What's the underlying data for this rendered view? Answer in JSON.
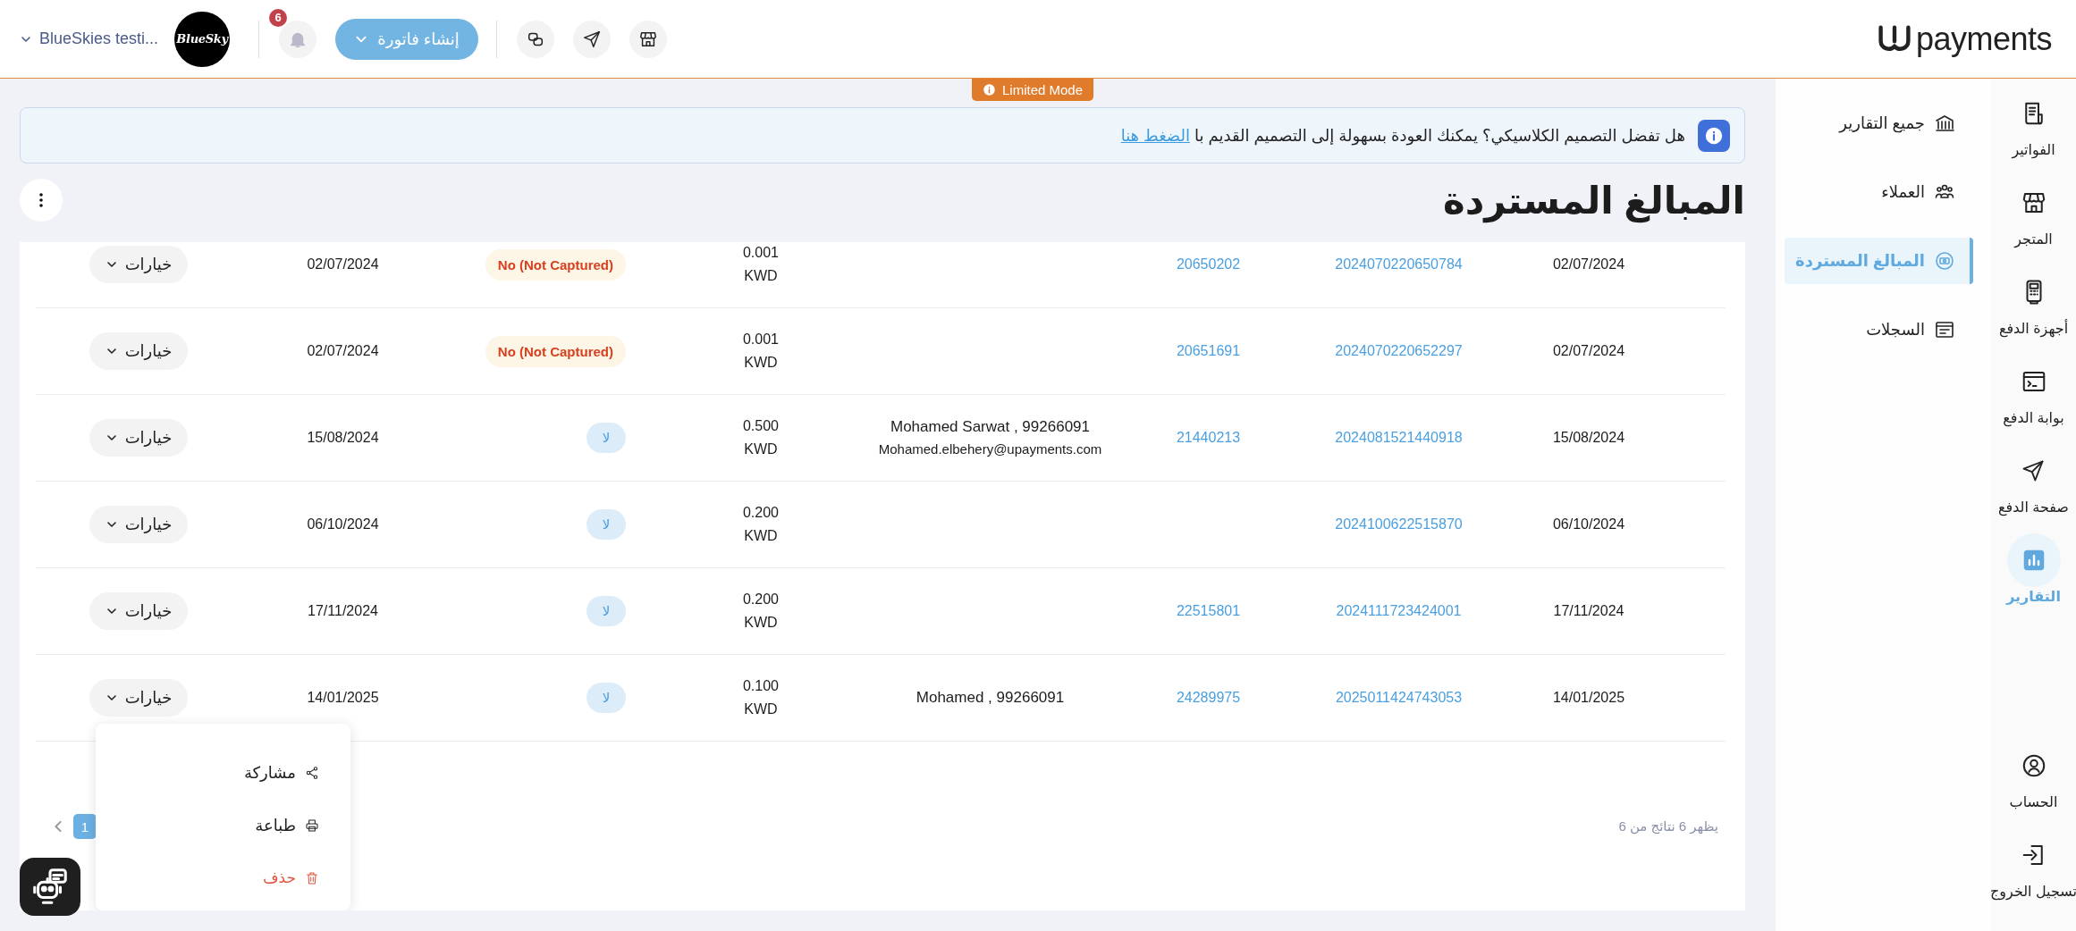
{
  "topbar": {
    "account": "BlueSkies testi...",
    "avatar": "BlueSky",
    "notifications": "6",
    "create_button": "إنشاء فاتورة",
    "logo": "payments"
  },
  "limited_mode": "Limited Mode",
  "banner": {
    "text": "هل تفضل التصميم الكلاسيكي؟ يمكنك العودة بسهولة إلى التصميم القديم با",
    "link": "الضغط هنا"
  },
  "page_title": "المبالغ المستردة",
  "rows": [
    {
      "date": "02/07/2024",
      "reference": "2024070220650784",
      "payment_id": "20650202",
      "amount": "0.001",
      "currency": "KWD",
      "status": {
        "kind": "not_captured",
        "label": "No (Not Captured)"
      },
      "refund_date": "02/07/2024",
      "options": "خيارات"
    },
    {
      "date": "02/07/2024",
      "reference": "2024070220652297",
      "payment_id": "20651691",
      "amount": "0.001",
      "currency": "KWD",
      "status": {
        "kind": "not_captured",
        "label": "No (Not Captured)"
      },
      "refund_date": "02/07/2024",
      "options": "خيارات"
    },
    {
      "date": "15/08/2024",
      "reference": "2024081521440918",
      "payment_id": "21440213",
      "customer": "Mohamed Sarwat , 99266091",
      "email": "Mohamed.elbehery@upayments.com",
      "amount": "0.500",
      "currency": "KWD",
      "status": {
        "kind": "no",
        "label": "لا"
      },
      "refund_date": "15/08/2024",
      "options": "خيارات"
    },
    {
      "date": "06/10/2024",
      "reference": "2024100622515870",
      "amount": "0.200",
      "currency": "KWD",
      "status": {
        "kind": "no",
        "label": "لا"
      },
      "refund_date": "06/10/2024",
      "options": "خيارات"
    },
    {
      "date": "17/11/2024",
      "reference": "2024111723424001",
      "payment_id": "22515801",
      "amount": "0.200",
      "currency": "KWD",
      "status": {
        "kind": "no",
        "label": "لا"
      },
      "refund_date": "17/11/2024",
      "options": "خيارات"
    },
    {
      "date": "14/01/2025",
      "reference": "2025011424743053",
      "payment_id": "24289975",
      "customer": "Mohamed , 99266091",
      "amount": "0.100",
      "currency": "KWD",
      "status": {
        "kind": "no",
        "label": "لا"
      },
      "refund_date": "14/01/2025",
      "options": "خيارات"
    }
  ],
  "row_menu": [
    {
      "label": "مشاركة",
      "kind": "share"
    },
    {
      "label": "طباعة",
      "kind": "print"
    },
    {
      "label": "حذف",
      "kind": "delete"
    }
  ],
  "pagination": {
    "summary": "يظهر 6 نتائج من 6",
    "pages": [
      {
        "label": "1",
        "selected": true
      }
    ]
  },
  "subnav": [
    {
      "label": "جميع التقارير",
      "selected": false
    },
    {
      "label": "العملاء",
      "selected": false
    },
    {
      "label": "المبالغ المستردة",
      "selected": true
    },
    {
      "label": "السجلات",
      "selected": false
    }
  ],
  "rail": [
    {
      "label": "الفواتير",
      "selected": false
    },
    {
      "label": "المتجر",
      "selected": false
    },
    {
      "label": "أجهزة الدفع",
      "selected": false
    },
    {
      "label": "بوابة الدفع",
      "selected": false
    },
    {
      "label": "صفحة الدفع",
      "selected": false
    },
    {
      "label": "التقارير",
      "selected": true
    }
  ],
  "rail_bottom": [
    {
      "label": "الحساب",
      "selected": false
    },
    {
      "label": "تسجيل الخروج",
      "selected": false
    }
  ]
}
